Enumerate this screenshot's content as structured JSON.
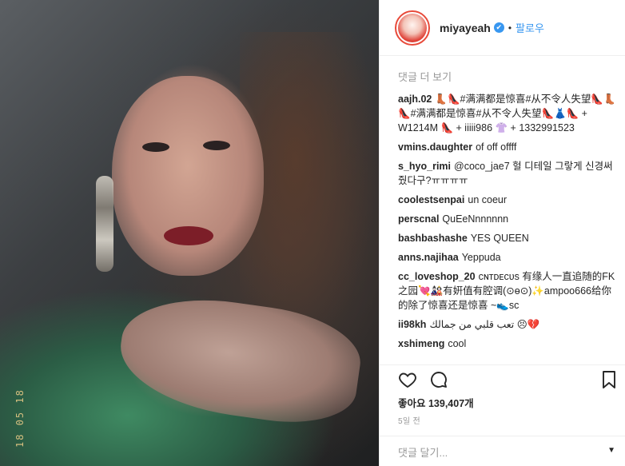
{
  "header": {
    "username": "miyayeah",
    "verified_badge": "✔",
    "separator": "•",
    "follow_label": "팔로우"
  },
  "comments_section": {
    "load_more_label": "댓글 더 보기",
    "items": [
      {
        "user": "aajh.02",
        "text": "👢👠#满满都是惊喜#从不令人失望👠👢👠#满满都是惊喜#从不令人失望👠👗👠 + W1214M 👠 + iiiii986 👚 + 1332991523"
      },
      {
        "user": "vmins.daughter",
        "text": "of off offff"
      },
      {
        "user": "s_hyo_rimi",
        "text": "@coco_jae7 헐 디테일 그랗게 신경써줬다구?ㅠㅠㅠㅠ"
      },
      {
        "user": "coolestsenpai",
        "text": "un coeur"
      },
      {
        "user": "perscnal",
        "text": "QuEeNnnnnnn"
      },
      {
        "user": "bashbashashe",
        "text": "YES QUEEN"
      },
      {
        "user": "anns.najihaa",
        "text": "Yeppuda"
      },
      {
        "user": "cc_loveshop_20",
        "text": "ᴄɴᴛᴅᴇᴄᴜs 有缘人一直追随的FK之园💘🎎有姸值有腔调(⊙ө⊙)✨ampoo666给你的除了惊喜还是惊喜 ~👟sc"
      },
      {
        "user": "ii98kh",
        "text": "تعب قلبي من جمالك 😣💔"
      },
      {
        "user": "xshimeng",
        "text": "cool"
      }
    ]
  },
  "actions": {
    "like_icon": "heart-icon",
    "comment_icon": "speech-bubble-icon",
    "save_icon": "bookmark-icon"
  },
  "likes_text": "좋아요 139,407개",
  "timestamp": "5일 전",
  "add_comment_placeholder": "댓글 달기...",
  "photo": {
    "date_stamp": "18 05 18"
  }
}
